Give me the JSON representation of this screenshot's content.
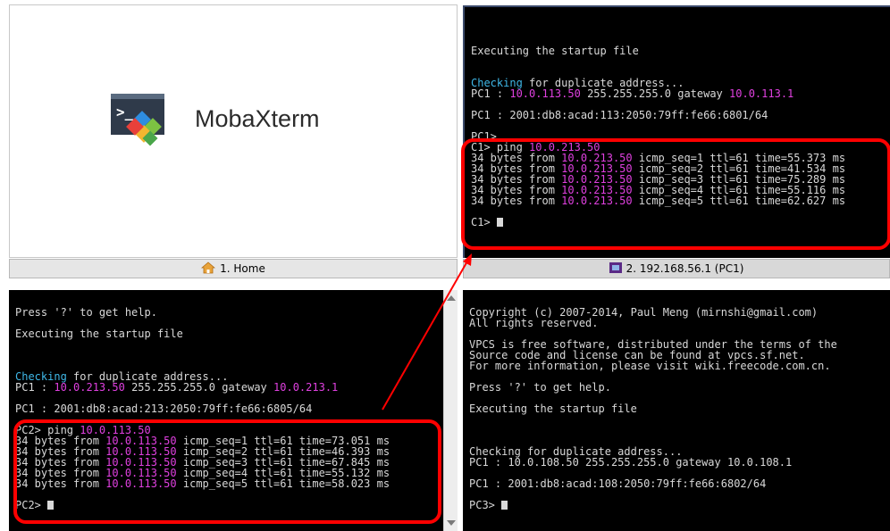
{
  "home": {
    "app_name": "MobaXterm",
    "tab_label": "1. Home",
    "tab_icon": "home-icon"
  },
  "pc1": {
    "tab_label": "2. 192.168.56.1 (PC1)",
    "tab_icon": "terminal-icon",
    "lines": [
      [],
      [
        {
          "t": "Executing the startup file"
        }
      ],
      [],
      [],
      [
        {
          "t": "Checking",
          "c": "cyan"
        },
        {
          "t": " for duplicate address..."
        }
      ],
      [
        {
          "t": "PC1 : "
        },
        {
          "t": "10.0.113.50",
          "c": "mag"
        },
        {
          "t": " 255.255.255.0 gateway "
        },
        {
          "t": "10.0.113.1",
          "c": "mag"
        }
      ],
      [],
      [
        {
          "t": "PC1 : 2001:db8:acad:113:2050:79ff:fe66:6801/64"
        }
      ],
      [],
      [
        {
          "t": "PC1>"
        }
      ],
      [
        {
          "t": "C1> ping "
        },
        {
          "t": "10.0.213.50",
          "c": "mag"
        }
      ],
      [
        {
          "t": "34 bytes from "
        },
        {
          "t": "10.0.213.50",
          "c": "mag"
        },
        {
          "t": " icmp_seq=1 ttl=61 time=55.373 ms"
        }
      ],
      [
        {
          "t": "34 bytes from "
        },
        {
          "t": "10.0.213.50",
          "c": "mag"
        },
        {
          "t": " icmp_seq=2 ttl=61 time=41.534 ms"
        }
      ],
      [
        {
          "t": "34 bytes from "
        },
        {
          "t": "10.0.213.50",
          "c": "mag"
        },
        {
          "t": " icmp_seq=3 ttl=61 time=75.289 ms"
        }
      ],
      [
        {
          "t": "34 bytes from "
        },
        {
          "t": "10.0.213.50",
          "c": "mag"
        },
        {
          "t": " icmp_seq=4 ttl=61 time=55.116 ms"
        }
      ],
      [
        {
          "t": "34 bytes from "
        },
        {
          "t": "10.0.213.50",
          "c": "mag"
        },
        {
          "t": " icmp_seq=5 ttl=61 time=62.627 ms"
        }
      ],
      [],
      [
        {
          "t": "C1> "
        },
        {
          "cursor": true
        }
      ]
    ]
  },
  "pc2": {
    "lines": [
      [
        {
          "t": "Press '?' to get help."
        }
      ],
      [],
      [
        {
          "t": "Executing the startup file"
        }
      ],
      [],
      [],
      [],
      [
        {
          "t": "Checking",
          "c": "cyan"
        },
        {
          "t": " for duplicate address..."
        }
      ],
      [
        {
          "t": "PC1 : "
        },
        {
          "t": "10.0.213.50",
          "c": "mag"
        },
        {
          "t": " 255.255.255.0 gateway "
        },
        {
          "t": "10.0.213.1",
          "c": "mag"
        }
      ],
      [],
      [
        {
          "t": "PC1 : 2001:db8:acad:213:2050:79ff:fe66:6805/64"
        }
      ],
      [],
      [
        {
          "t": "PC2> ping "
        },
        {
          "t": "10.0.113.50",
          "c": "mag"
        }
      ],
      [
        {
          "t": "34 bytes from "
        },
        {
          "t": "10.0.113.50",
          "c": "mag"
        },
        {
          "t": " icmp_seq=1 ttl=61 time=73.051 ms"
        }
      ],
      [
        {
          "t": "34 bytes from "
        },
        {
          "t": "10.0.113.50",
          "c": "mag"
        },
        {
          "t": " icmp_seq=2 ttl=61 time=46.393 ms"
        }
      ],
      [
        {
          "t": "34 bytes from "
        },
        {
          "t": "10.0.113.50",
          "c": "mag"
        },
        {
          "t": " icmp_seq=3 ttl=61 time=67.845 ms"
        }
      ],
      [
        {
          "t": "34 bytes from "
        },
        {
          "t": "10.0.113.50",
          "c": "mag"
        },
        {
          "t": " icmp_seq=4 ttl=61 time=55.132 ms"
        }
      ],
      [
        {
          "t": "34 bytes from "
        },
        {
          "t": "10.0.113.50",
          "c": "mag"
        },
        {
          "t": " icmp_seq=5 ttl=61 time=58.023 ms"
        }
      ],
      [],
      [
        {
          "t": "PC2> "
        },
        {
          "cursor": true
        }
      ]
    ]
  },
  "pc3": {
    "lines": [
      [
        {
          "t": "Copyright (c) 2007-2014, Paul Meng (mirnshi@gmail.com)"
        }
      ],
      [
        {
          "t": "All rights reserved."
        }
      ],
      [],
      [
        {
          "t": "VPCS is free software, distributed under the terms of the"
        }
      ],
      [
        {
          "t": "Source code and license can be found at vpcs.sf.net."
        }
      ],
      [
        {
          "t": "For more information, please visit wiki.freecode.com.cn."
        }
      ],
      [],
      [
        {
          "t": "Press '?' to get help."
        }
      ],
      [],
      [
        {
          "t": "Executing the startup file"
        }
      ],
      [],
      [],
      [],
      [
        {
          "t": "Checking for duplicate address..."
        }
      ],
      [
        {
          "t": "PC1 : 10.0.108.50 255.255.255.0 gateway 10.0.108.1"
        }
      ],
      [],
      [
        {
          "t": "PC1 : 2001:db8:acad:108:2050:79ff:fe66:6802/64"
        }
      ],
      [],
      [
        {
          "t": "PC3> "
        },
        {
          "cursor": true
        }
      ]
    ]
  },
  "colors": {
    "terminal_bg": "#000000",
    "terminal_fg": "#d9d9d9",
    "ip_highlight": "#e040e0",
    "checking_highlight": "#3fb8e8",
    "annotation_red": "#ff0000"
  }
}
